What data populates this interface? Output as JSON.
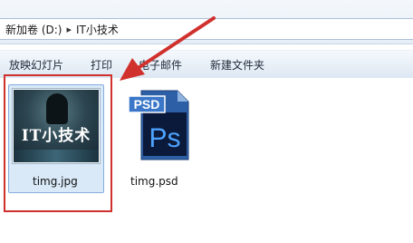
{
  "address_bar": {
    "crumbs": [
      "新加卷 (D:)",
      "IT小技术"
    ]
  },
  "toolbar": {
    "buttons": [
      "放映幻灯片",
      "打印",
      "电子邮件",
      "新建文件夹"
    ]
  },
  "files": [
    {
      "name": "timg.jpg",
      "thumbnail_text": "IT小技术",
      "selected": true
    },
    {
      "name": "timg.psd",
      "icon_badge": "PSD",
      "icon_letters": "Ps",
      "selected": false
    }
  ],
  "colors": {
    "highlight": "#d0312d",
    "selection_fill": "#d9e9f8",
    "psd_blue": "#2d5fa6"
  }
}
